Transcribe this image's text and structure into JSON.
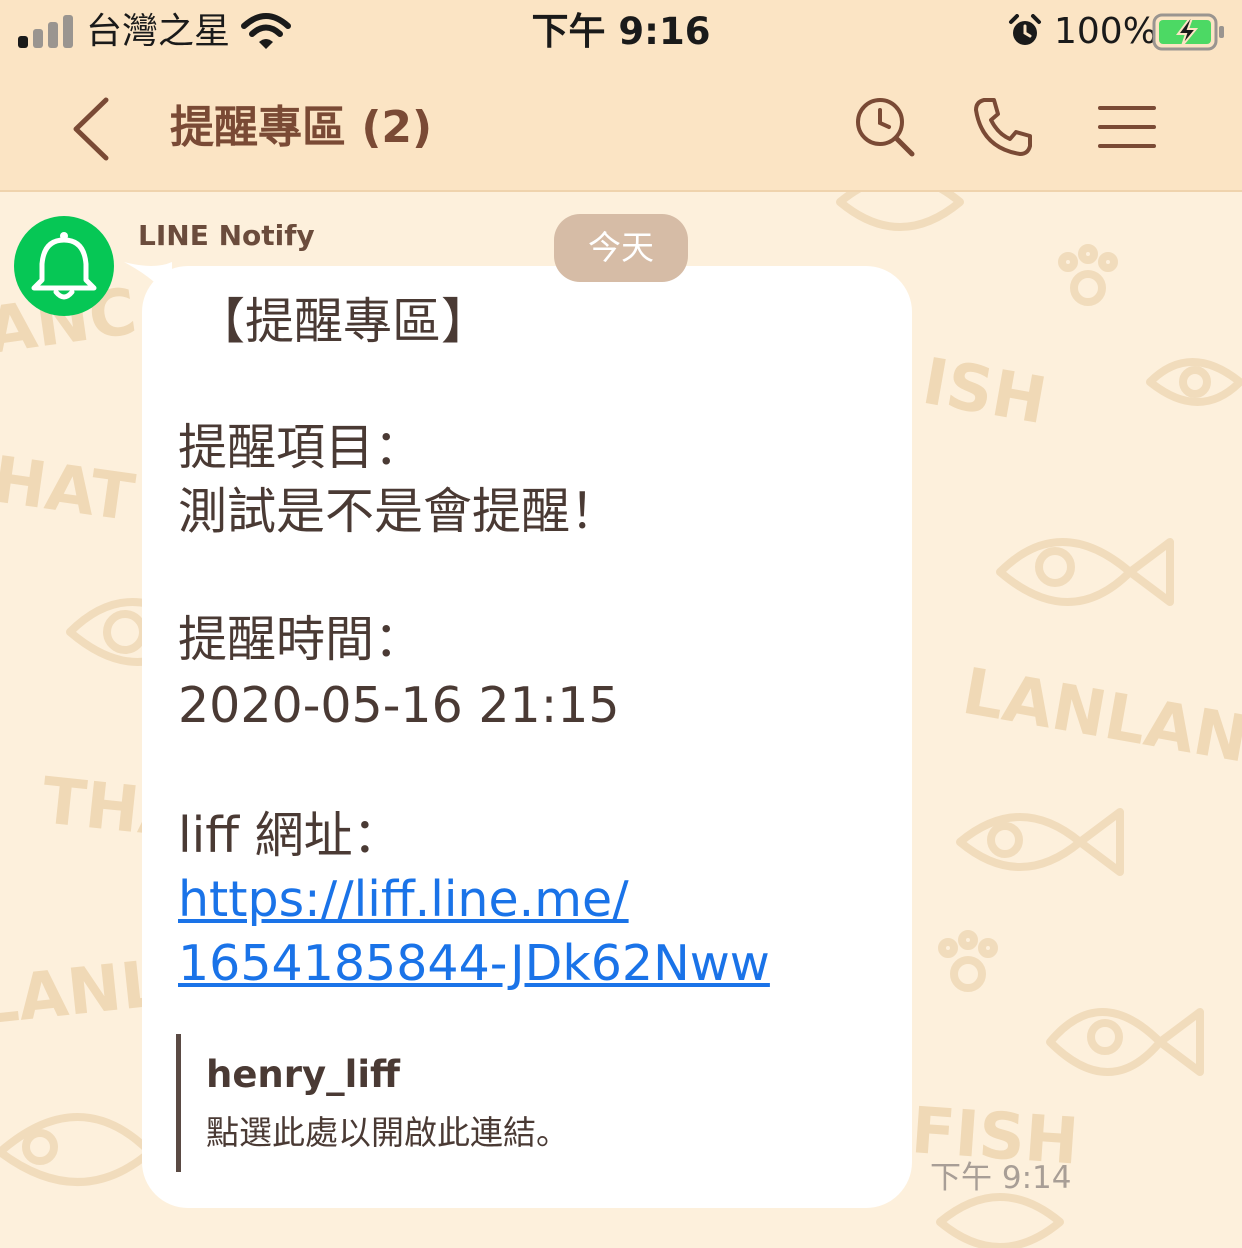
{
  "status_bar": {
    "carrier": "台灣之星",
    "time": "下午 9:16",
    "battery_percent": "100%",
    "icons": [
      "signal-icon",
      "wifi-icon",
      "alarm-icon",
      "battery-charging-icon"
    ]
  },
  "nav": {
    "title": "提醒專區 (2)",
    "icons": [
      "back-chevron-icon",
      "search-icon",
      "phone-icon",
      "menu-icon"
    ]
  },
  "chat": {
    "date_separator": "今天",
    "sender": "LINE Notify",
    "avatar_icon": "bell-icon",
    "message": {
      "header": "【提醒專區】",
      "item_label": "提醒項目：",
      "item_value": "測試是不是會提醒！",
      "time_label": "提醒時間：",
      "time_value": "2020-05-16 21:15",
      "url_label": "liff 網址：",
      "url_line1": "https://liff.line.me/",
      "url_line2": "1654185844-JDk62Nww"
    },
    "link_preview": {
      "title": "henry_liff",
      "description": "點選此處以開啟此連結。"
    },
    "timestamp": "下午 9:14"
  },
  "colors": {
    "header_bg": "#fbe4c4",
    "chat_bg": "#fdf0dc",
    "title_brown": "#7a4a35",
    "line_green": "#06c755",
    "link_blue": "#1a73e8",
    "date_pill": "#d6bca6",
    "battery_green": "#4cd964"
  }
}
